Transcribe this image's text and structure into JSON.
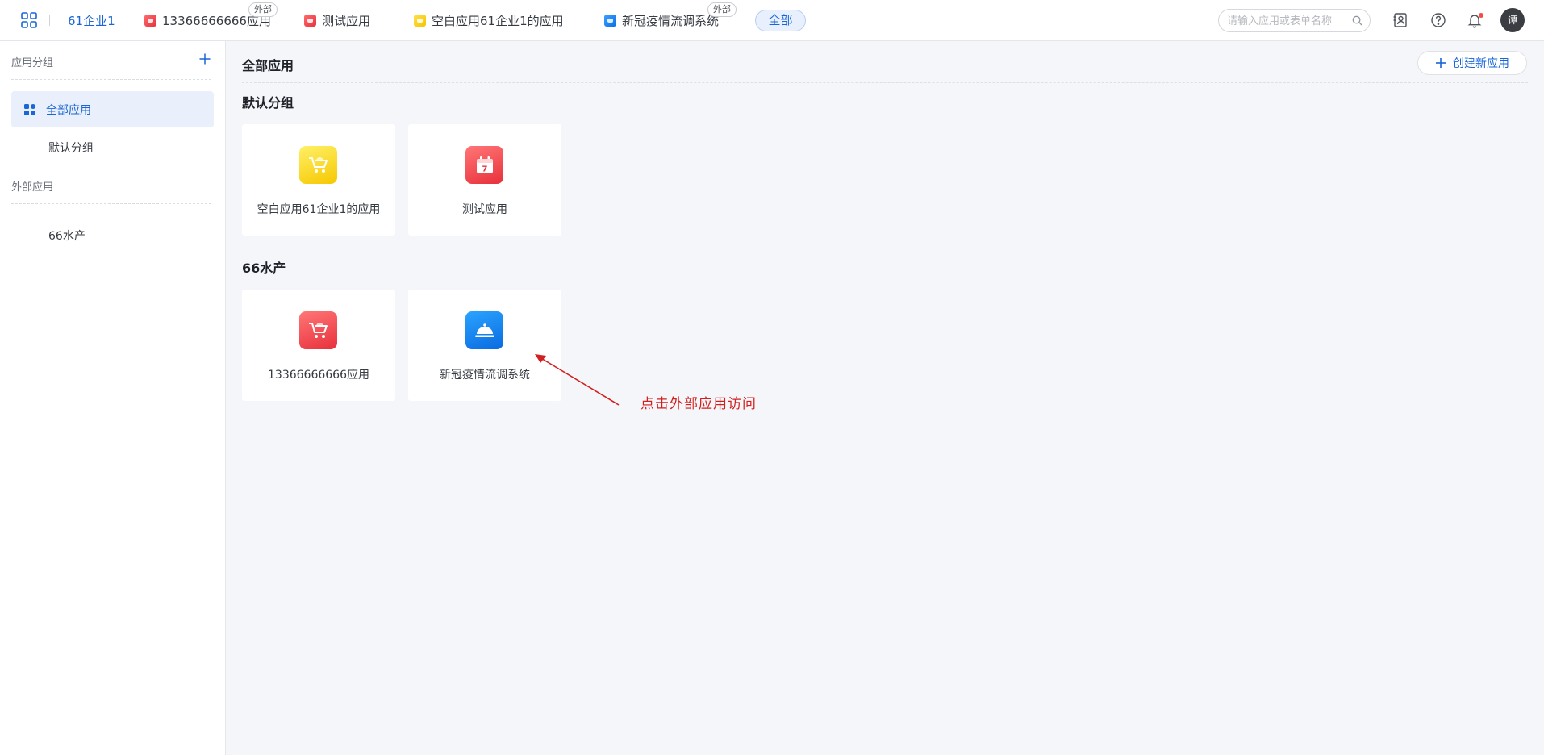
{
  "topbar": {
    "org_name": "61企业1",
    "tabs": [
      {
        "label": "13366666666应用",
        "badge": "外部",
        "icon": "cart-icon",
        "color": "#e5323e"
      },
      {
        "label": "测试应用",
        "icon": "calendar-icon",
        "color": "#e5323e"
      },
      {
        "label": "空白应用61企业1的应用",
        "icon": "cart-icon",
        "color": "#f5c400"
      },
      {
        "label": "新冠疫情流调系统",
        "badge": "外部",
        "icon": "cloche-icon",
        "color": "#0a6fe8"
      }
    ],
    "all_label": "全部",
    "search_placeholder": "请输入应用或表单名称",
    "avatar_text": "谭"
  },
  "sidebar": {
    "section_groups": "应用分组",
    "active_item": "全部应用",
    "items": [
      "默认分组"
    ],
    "section_external": "外部应用",
    "external_items": [
      "66水产"
    ]
  },
  "main": {
    "title": "全部应用",
    "create_label": "创建新应用",
    "groups": [
      {
        "title": "默认分组",
        "apps": [
          {
            "name": "空白应用61企业1的应用",
            "icon": "cart-icon",
            "color": "#f6c800"
          },
          {
            "name": "测试应用",
            "icon": "calendar-icon",
            "color": "#e8303c",
            "icon_text": "7"
          }
        ]
      },
      {
        "title": "66水产",
        "apps": [
          {
            "name": "13366666666应用",
            "icon": "cart-icon",
            "color": "#e8303c"
          },
          {
            "name": "新冠疫情流调系统",
            "icon": "cloche-icon",
            "color": "#0a6be0"
          }
        ]
      }
    ]
  },
  "annotation": {
    "text": "点击外部应用访问",
    "color": "#d21f1f"
  },
  "accent_color": "#1a66d6"
}
